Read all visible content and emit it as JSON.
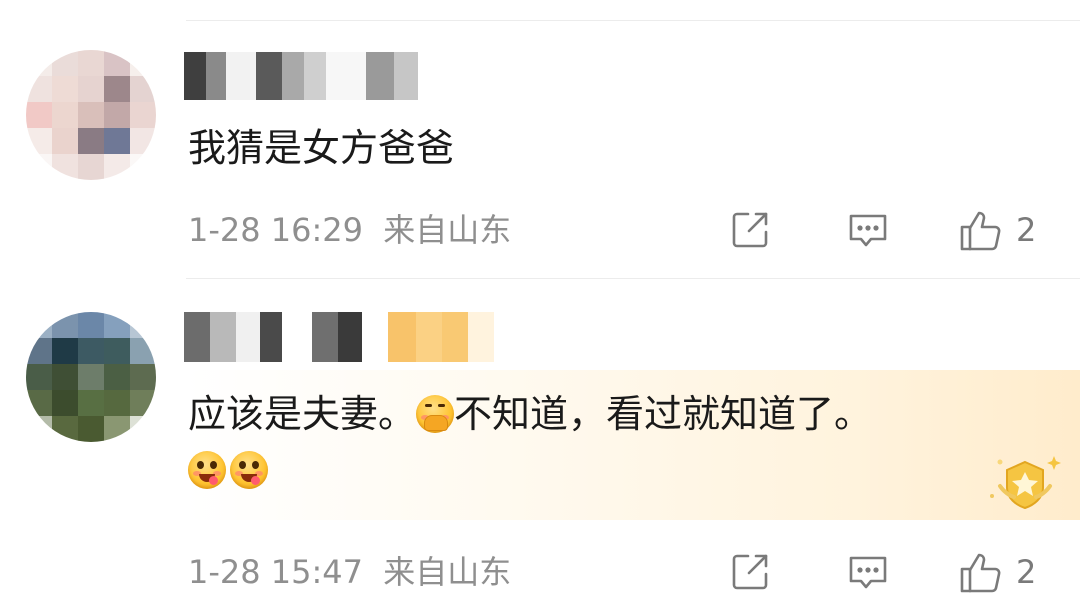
{
  "comments": [
    {
      "text": "我猜是女方爸爸",
      "time": "1-28 16:29",
      "location": "来自山东",
      "likes": "2"
    },
    {
      "text_part1": "应该是夫妻。",
      "text_part2": "不知道，看过就知道了。",
      "time": "1-28 15:47",
      "location": "来自山东",
      "likes": "2",
      "emojis": [
        "hands-together-emoji",
        "drooling-face-emoji",
        "drooling-face-emoji"
      ]
    }
  ],
  "icons": {
    "share": "share-icon",
    "reply": "comment-icon",
    "like": "thumbs-up-icon",
    "badge": "star-shield-badge-icon"
  },
  "colors": {
    "meta_text": "#8f8f8f",
    "body_text": "#1a1a1a",
    "highlight": "#fff3dd",
    "badge": "#f5c542"
  }
}
